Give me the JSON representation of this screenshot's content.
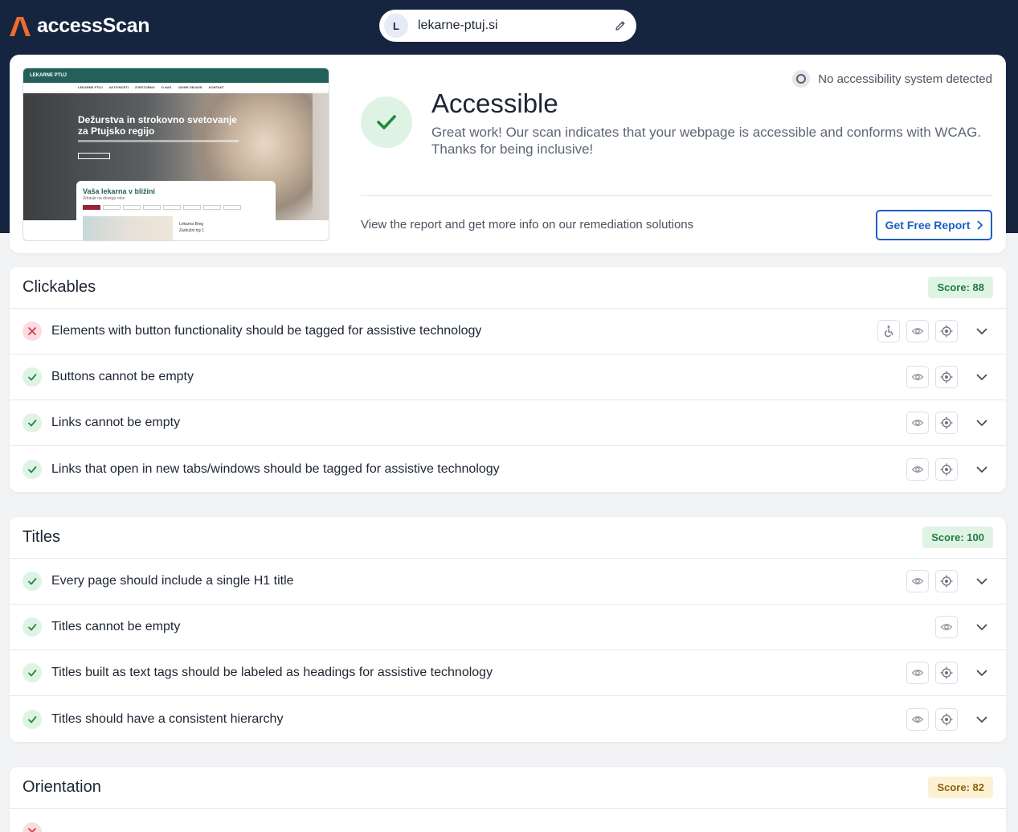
{
  "app": {
    "name": "accessScan",
    "brand_color": "#f26a2e",
    "header_bg": "#15243f"
  },
  "url_bar": {
    "avatar_letter": "L",
    "domain": "lekarne-ptuj.si"
  },
  "summary": {
    "thumbnail": {
      "logo": "LEKARNE PTUJ",
      "nav_items": [
        "LEKARNE PTUJ",
        "AKTIVNOSTI",
        "ZVESTOBNO",
        "O NAS",
        "JAVNE OBJAVE",
        "KONTAKT"
      ],
      "hero_title": "Dežurstva in strokovno svetovanje za Ptujsko regijo",
      "box_title": "Vaša lekarna v bližini",
      "box_sub": "Zdravje na dosegu roke",
      "list_a": "Lekarna Breg",
      "list_b": "Zadružni trg 1"
    },
    "no_system": "No accessibility system detected",
    "status_title": "Accessible",
    "status_desc": "Great work! Our scan indicates that your webpage is accessible and conforms with WCAG. Thanks for being inclusive!",
    "report_text": "View the report and get more info on our remediation solutions",
    "report_button": "Get Free Report"
  },
  "sections": [
    {
      "title": "Clickables",
      "score": "Score: 88",
      "rules": [
        {
          "label": "Elements with button functionality should be tagged for assistive technology",
          "status": "fail"
        },
        {
          "label": "Buttons cannot be empty",
          "status": "pass"
        },
        {
          "label": "Links cannot be empty",
          "status": "pass"
        },
        {
          "label": "Links that open in new tabs/windows should be tagged for assistive technology",
          "status": "pass"
        }
      ]
    },
    {
      "title": "Titles",
      "score": "Score: 100",
      "rules": [
        {
          "label": "Every page should include a single H1 title",
          "status": "pass"
        },
        {
          "label": "Titles cannot be empty",
          "status": "pass"
        },
        {
          "label": "Titles built as text tags should be labeled as headings for assistive technology",
          "status": "pass"
        },
        {
          "label": "Titles should have a consistent hierarchy",
          "status": "pass"
        }
      ]
    },
    {
      "title": "Orientation",
      "score": "Score: 82"
    }
  ]
}
